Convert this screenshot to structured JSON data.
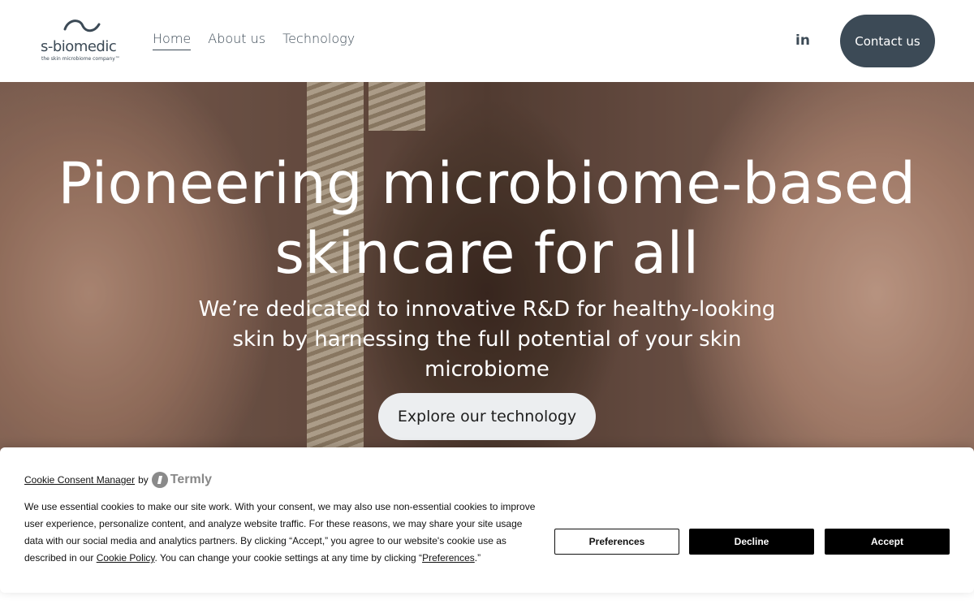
{
  "header": {
    "logo_text": "s-biomedic",
    "logo_tagline": "the skin microbiome company™",
    "nav": [
      {
        "label": "Home"
      },
      {
        "label": "About us"
      },
      {
        "label": "Technology"
      }
    ],
    "linkedin_glyph": "in",
    "contact_label": "Contact us"
  },
  "hero": {
    "title": "Pioneering microbiome-based skincare for all",
    "subtitle": "We’re dedicated to innovative R&D for healthy-looking skin by harnessing the full potential of your skin microbiome",
    "cta_label": "Explore our technology"
  },
  "cookie_banner": {
    "manager_link": "Cookie Consent Manager",
    "by": "by",
    "brand": "Termly",
    "text_part1": "We use essential cookies to make our site work. With your consent, we may also use non-essential cookies to improve user experience, personalize content, and analyze website traffic. For these reasons, we may share your site usage data with our social media and analytics partners. By clicking “Accept,” you agree to our website's cookie use as described in our ",
    "policy_link": "Cookie Policy",
    "text_part2": ". You can change your cookie settings at any time by clicking “",
    "preferences_link": "Preferences",
    "text_part3": ".”",
    "buttons": {
      "preferences": "Preferences",
      "decline": "Decline",
      "accept": "Accept"
    }
  },
  "colors": {
    "brand_dark": "#3c4a56",
    "button_black": "#000000"
  },
  "icons": [
    "logo-swoosh-icon",
    "linkedin-icon",
    "termly-logo-icon"
  ]
}
